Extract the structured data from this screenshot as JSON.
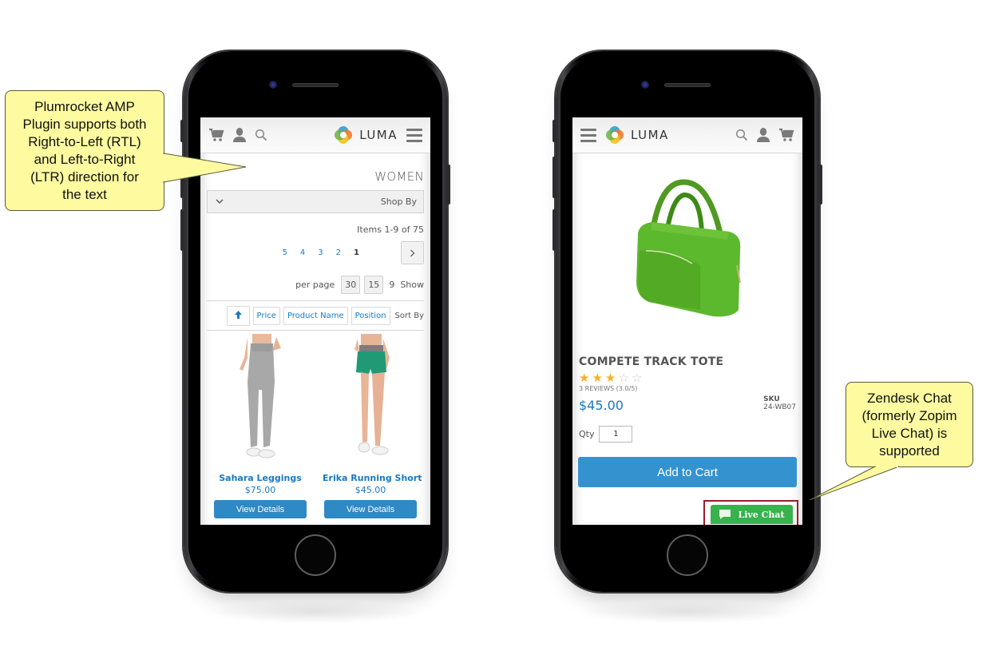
{
  "callouts": {
    "rtl": "Plumrocket AMP\nPlugin supports both\nRight-to-Left (RTL)\nand Left-to-Right\n(LTR) direction for\nthe text",
    "chat": "Zendesk Chat\n(formerly Zopim\nLive Chat) is\nsupported"
  },
  "brand": {
    "name": "LUMA",
    "accent": "#1979c3",
    "button_blue": "#3493cf",
    "chat_green": "#37b24d",
    "callout_fill": "#fdfaa0"
  },
  "left_screen": {
    "header_icons": [
      "cart-icon",
      "account-icon",
      "search-icon"
    ],
    "category_title": "WOMEN",
    "shop_by": "Shop By",
    "items_count": "Items 1-9 of 75",
    "pages": [
      "5",
      "4",
      "3",
      "2",
      "1"
    ],
    "current_page": "1",
    "next_label": ">",
    "per_page": {
      "label": "per page",
      "options": [
        "30",
        "15",
        "9"
      ],
      "show_label": "Show"
    },
    "sort": {
      "direction_icon": "arrow-up-icon",
      "options": [
        "Price",
        "Product Name",
        "Position"
      ],
      "label": "Sort By"
    },
    "products": [
      {
        "name": "Sahara Leggings",
        "price": "$75.00",
        "button": "View Details"
      },
      {
        "name": "Erika Running Short",
        "price": "$45.00",
        "button": "View Details"
      }
    ]
  },
  "right_screen": {
    "header_icons": [
      "search-icon",
      "account-icon",
      "cart-icon"
    ],
    "product_title": "COMPETE TRACK TOTE",
    "rating": {
      "value": 3,
      "max": 5
    },
    "reviews": "3 REVIEWS (3.0/5)",
    "price": "$45.00",
    "sku_label": "SKU",
    "sku_value": "24-WB07",
    "qty_label": "Qty",
    "qty_value": "1",
    "add_to_cart": "Add to Cart",
    "live_chat": "Live Chat"
  }
}
